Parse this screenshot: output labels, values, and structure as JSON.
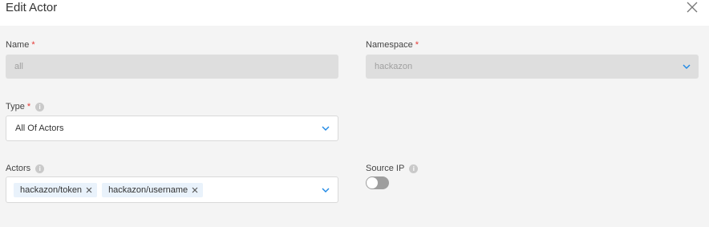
{
  "dialog": {
    "title": "Edit Actor"
  },
  "icons": {
    "close": "close-icon",
    "chevron": "chevron-down-icon",
    "info": "info-icon",
    "remove": "tag-remove-icon"
  },
  "colors": {
    "accent": "#1e88e5",
    "required": "#e53935",
    "tag_bg": "#e9f2fb",
    "toggle_off": "#9e9e9e"
  },
  "form": {
    "name": {
      "label": "Name",
      "required_mark": "*",
      "value": "all"
    },
    "namespace": {
      "label": "Namespace",
      "required_mark": "*",
      "value": "hackazon"
    },
    "type": {
      "label": "Type",
      "required_mark": "*",
      "info": "i",
      "value": "All Of Actors"
    },
    "actors": {
      "label": "Actors",
      "info": "i",
      "tags": [
        "hackazon/token",
        "hackazon/username"
      ]
    },
    "source_ip": {
      "label": "Source IP",
      "info": "i",
      "enabled": false
    }
  }
}
